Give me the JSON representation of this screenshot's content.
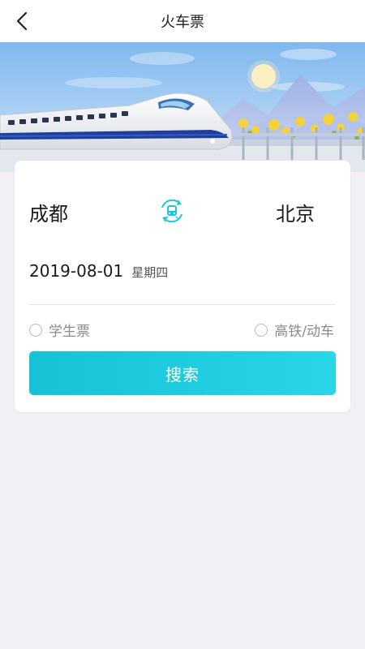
{
  "header": {
    "title": "火车票",
    "back_icon": "chevron-left-icon"
  },
  "banner": {
    "illustration": "high-speed-train-scene"
  },
  "search_form": {
    "from_city": "成都",
    "to_city": "北京",
    "swap_icon": "swap-train-icon",
    "date": "2019-08-01",
    "weekday": "星期四",
    "options": [
      {
        "label": "学生票",
        "checked": false
      },
      {
        "label": "高铁/动车",
        "checked": false
      }
    ],
    "search_label": "搜索"
  },
  "colors": {
    "accent": "#1ec8dc",
    "background": "#f0f0f5",
    "card": "#ffffff"
  }
}
